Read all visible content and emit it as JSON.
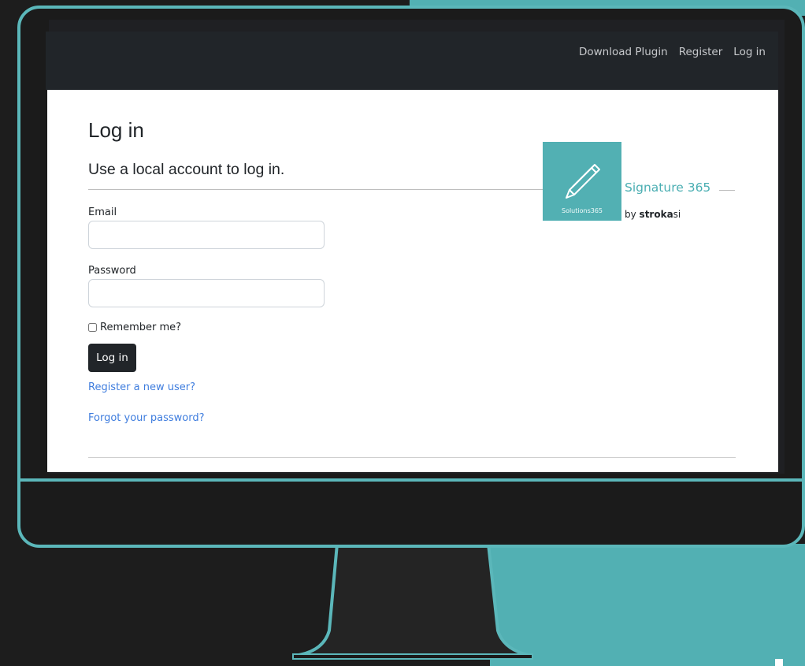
{
  "nav": {
    "links": [
      "Download Plugin",
      "Register",
      "Log in"
    ]
  },
  "main": {
    "title": "Log in",
    "subtitle": "Use a local account to log in.",
    "email_label": "Email",
    "email_value": "",
    "password_label": "Password",
    "password_value": "",
    "remember_label": "Remember me?",
    "remember_checked": false,
    "login_button": "Log in",
    "register_link": "Register a new user?",
    "forgot_link": "Forgot your password?"
  },
  "brand": {
    "logo_caption": "Solutions365",
    "title": "Signature 365",
    "by_prefix": "by ",
    "by_bold": "stroka",
    "by_suffix": "si",
    "logo_icon": "pencil-icon"
  },
  "colors": {
    "teal": "#52b0b3",
    "navbar": "#212529",
    "link": "#3f7dde",
    "background": "#1d1d1d"
  }
}
